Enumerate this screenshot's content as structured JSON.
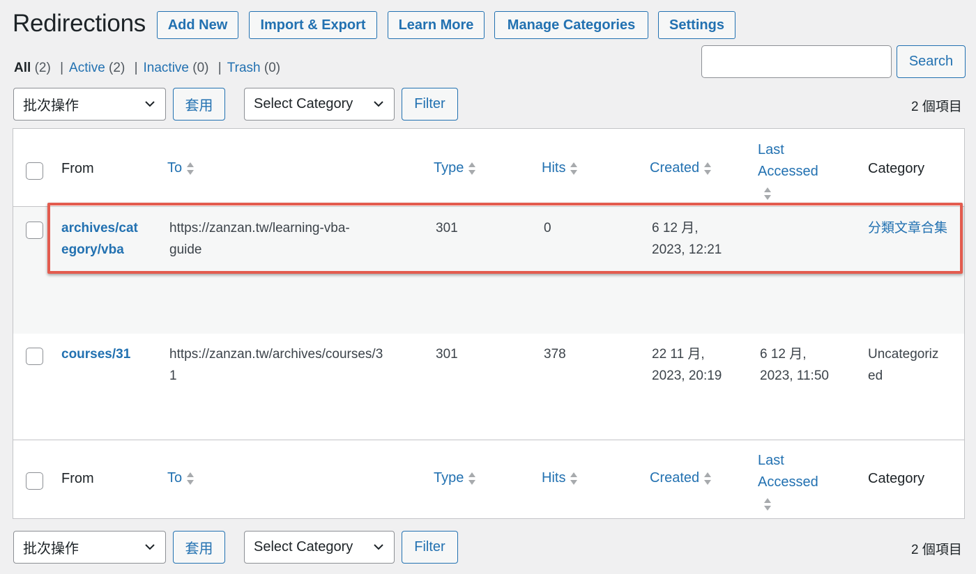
{
  "header": {
    "title": "Redirections",
    "buttons": [
      "Add New",
      "Import & Export",
      "Learn More",
      "Manage Categories",
      "Settings"
    ]
  },
  "filters": {
    "all_label": "All",
    "all_count": "(2)",
    "active_label": "Active",
    "active_count": "(2)",
    "inactive_label": "Inactive",
    "inactive_count": "(0)",
    "trash_label": "Trash",
    "trash_count": "(0)",
    "separator": "|"
  },
  "search": {
    "value": "",
    "button": "Search"
  },
  "toolbar": {
    "bulk_action": "批次操作",
    "apply": "套用",
    "category": "Select Category",
    "filter": "Filter",
    "items_count": "2 個項目"
  },
  "table": {
    "columns": {
      "from": "From",
      "to": "To",
      "type": "Type",
      "hits": "Hits",
      "created": "Created",
      "last_accessed_1": "Last",
      "last_accessed_2": "Accessed",
      "category": "Category"
    },
    "rows": [
      {
        "from_1": "archives/cat",
        "from_2": "egory/vba",
        "to_1": "https://zanzan.tw/learning-vba-",
        "to_2": "guide",
        "type": "301",
        "hits": "0",
        "created_1": "6 12 月,",
        "created_2": "2023, 12:21",
        "last_1": "",
        "last_2": "",
        "category": "分類文章合集"
      },
      {
        "from_1": "courses/31",
        "from_2": "",
        "to_1": "https://zanzan.tw/archives/courses/3",
        "to_2": "1",
        "type": "301",
        "hits": "378",
        "created_1": "22 11 月,",
        "created_2": "2023, 20:19",
        "last_1": "6 12 月,",
        "last_2": "2023, 11:50",
        "category_1": "Uncategoriz",
        "category_2": "ed"
      }
    ]
  },
  "colors": {
    "accent": "#2271b1",
    "highlight": "#e35c4f"
  }
}
